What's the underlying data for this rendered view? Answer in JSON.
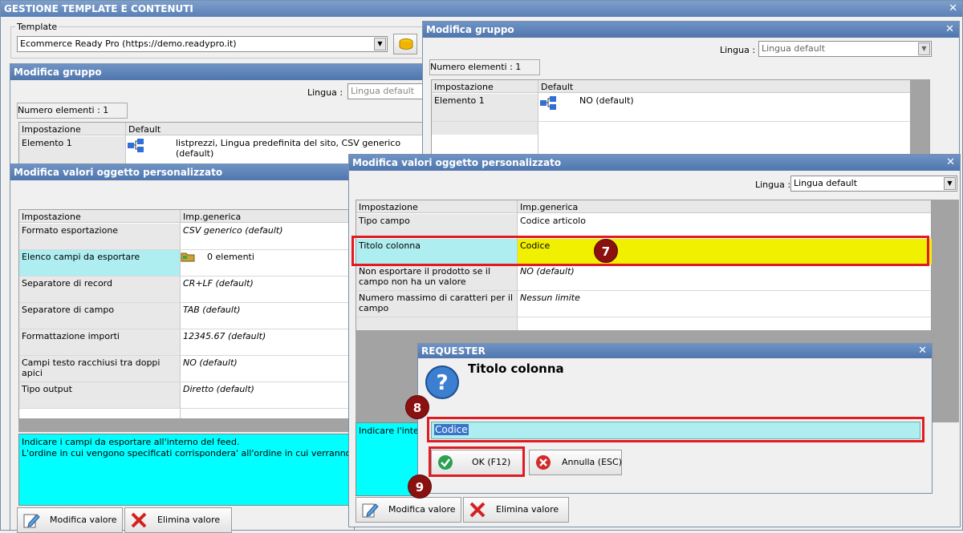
{
  "main": {
    "title": "GESTIONE TEMPLATE E CONTENUTI",
    "template_label": "Template",
    "template_value": "Ecommerce Ready Pro (https://demo.readypro.it)"
  },
  "group_left": {
    "title": "Modifica gruppo",
    "lingua_label": "Lingua :",
    "lingua_value": "Lingua default",
    "count_label": "Numero elementi : 1",
    "headers": [
      "Impostazione",
      "Default"
    ],
    "row_label": "Elemento 1",
    "row_value": "listprezzi, Lingua predefinita del sito, CSV generico (default)"
  },
  "obj_left": {
    "title": "Modifica valori oggetto personalizzato",
    "headers": [
      "Impostazione",
      "Imp.generica"
    ],
    "rows": [
      {
        "label": "Formato esportazione",
        "value": "CSV generico (default)"
      },
      {
        "label": "Elenco campi da esportare",
        "value": "0 elementi"
      },
      {
        "label": "Separatore di record",
        "value": "CR+LF (default)"
      },
      {
        "label": "Separatore di campo",
        "value": "TAB (default)"
      },
      {
        "label": "Formattazione importi",
        "value": "12345.67 (default)"
      },
      {
        "label": "Campi testo racchiusi tra doppi apici",
        "value": "NO (default)"
      },
      {
        "label": "Tipo output",
        "value": "Diretto (default)"
      }
    ],
    "desc_line1": "Indicare i campi da esportare all'interno del feed.",
    "desc_line2": "L'ordine in cui vengono specificati corrispondera' all'ordine in cui verranno esportate le",
    "edit_button": "Modifica valore",
    "delete_button": "Elimina valore"
  },
  "group_right": {
    "title": "Modifica gruppo",
    "lingua_label": "Lingua :",
    "lingua_value": "Lingua default",
    "count_label": "Numero elementi : 1",
    "headers": [
      "Impostazione",
      "Default"
    ],
    "row_label": "Elemento 1",
    "row_value": "NO (default)"
  },
  "obj_right": {
    "title": "Modifica valori oggetto personalizzato",
    "lingua_label": "Lingua :",
    "lingua_value": "Lingua default",
    "headers": [
      "Impostazione",
      "Imp.generica"
    ],
    "rows": [
      {
        "label": "Tipo campo",
        "value": "Codice articolo"
      },
      {
        "label": "Titolo colonna",
        "value": "Codice"
      },
      {
        "label": "Non esportare il prodotto se il campo non ha un valore",
        "value": "NO (default)"
      },
      {
        "label": "Numero massimo di caratteri per il campo",
        "value": "Nessun limite"
      }
    ],
    "desc": "Indicare l'intesta",
    "edit_button": "Modifica valore",
    "delete_button": "Elimina valore"
  },
  "requester": {
    "title": "REQUESTER",
    "heading": "Titolo colonna",
    "input_value": "Codice",
    "ok_button": "OK (F12)",
    "cancel_button": "Annulla (ESC)"
  },
  "badges": {
    "b7": "7",
    "b8": "8",
    "b9": "9"
  },
  "colors": {
    "title_bar": "#5b82b8",
    "highlight_row": "#f0f000",
    "cyan": "#00ffff",
    "annotation_red": "#e01b22"
  }
}
